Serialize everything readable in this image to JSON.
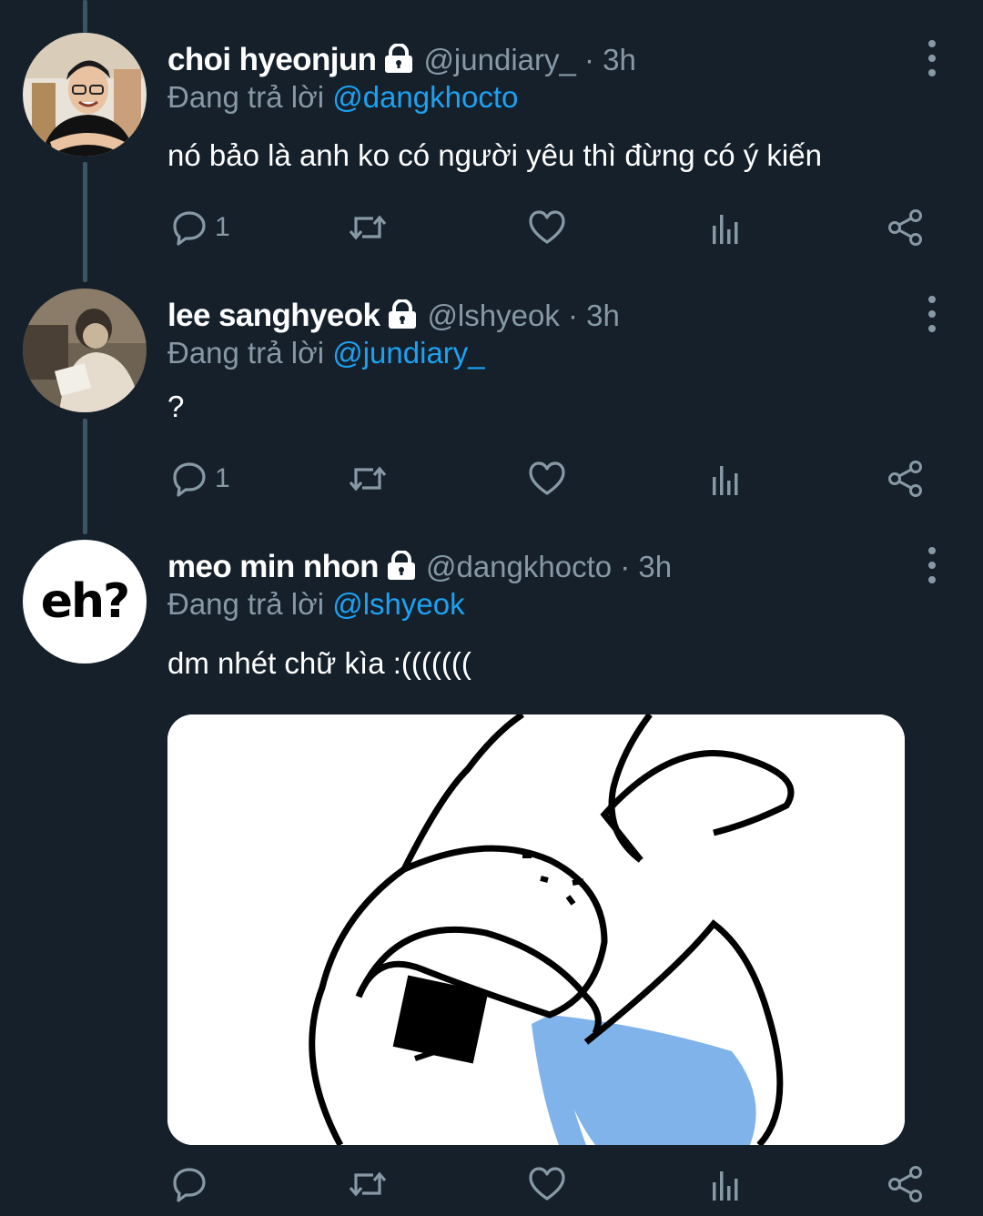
{
  "colors": {
    "background": "#15202b",
    "secondary_text": "#8899a6",
    "link": "#1da1f2",
    "thread_line": "#3d5466"
  },
  "tweets": [
    {
      "display_name": "choi hyeonjun",
      "handle_time": "@jundiary_ · 3h",
      "reply_prefix": "Đang trả lời",
      "reply_mention": "@dangkhocto",
      "text": "nó bảo là anh ko có người yêu thì đừng có ý kiến",
      "reply_count": "1",
      "protected_icon": "lock-icon"
    },
    {
      "display_name": "lee sanghyeok",
      "handle_time": "@lshyeok · 3h",
      "reply_prefix": "Đang trả lời",
      "reply_mention": "@jundiary_",
      "text": "?",
      "reply_count": "1",
      "protected_icon": "lock-icon"
    },
    {
      "display_name": "meo min nhon",
      "handle_time": "@dangkhocto · 3h",
      "reply_prefix": "Đang trả lời",
      "reply_mention": "@lshyeok",
      "text": "dm nhét chữ kìa :(((((((",
      "reply_count": "",
      "avatar_text": "eh?",
      "protected_icon": "lock-icon"
    }
  ],
  "action_icons": [
    "reply-icon",
    "retweet-icon",
    "like-icon",
    "analytics-icon",
    "share-icon"
  ]
}
